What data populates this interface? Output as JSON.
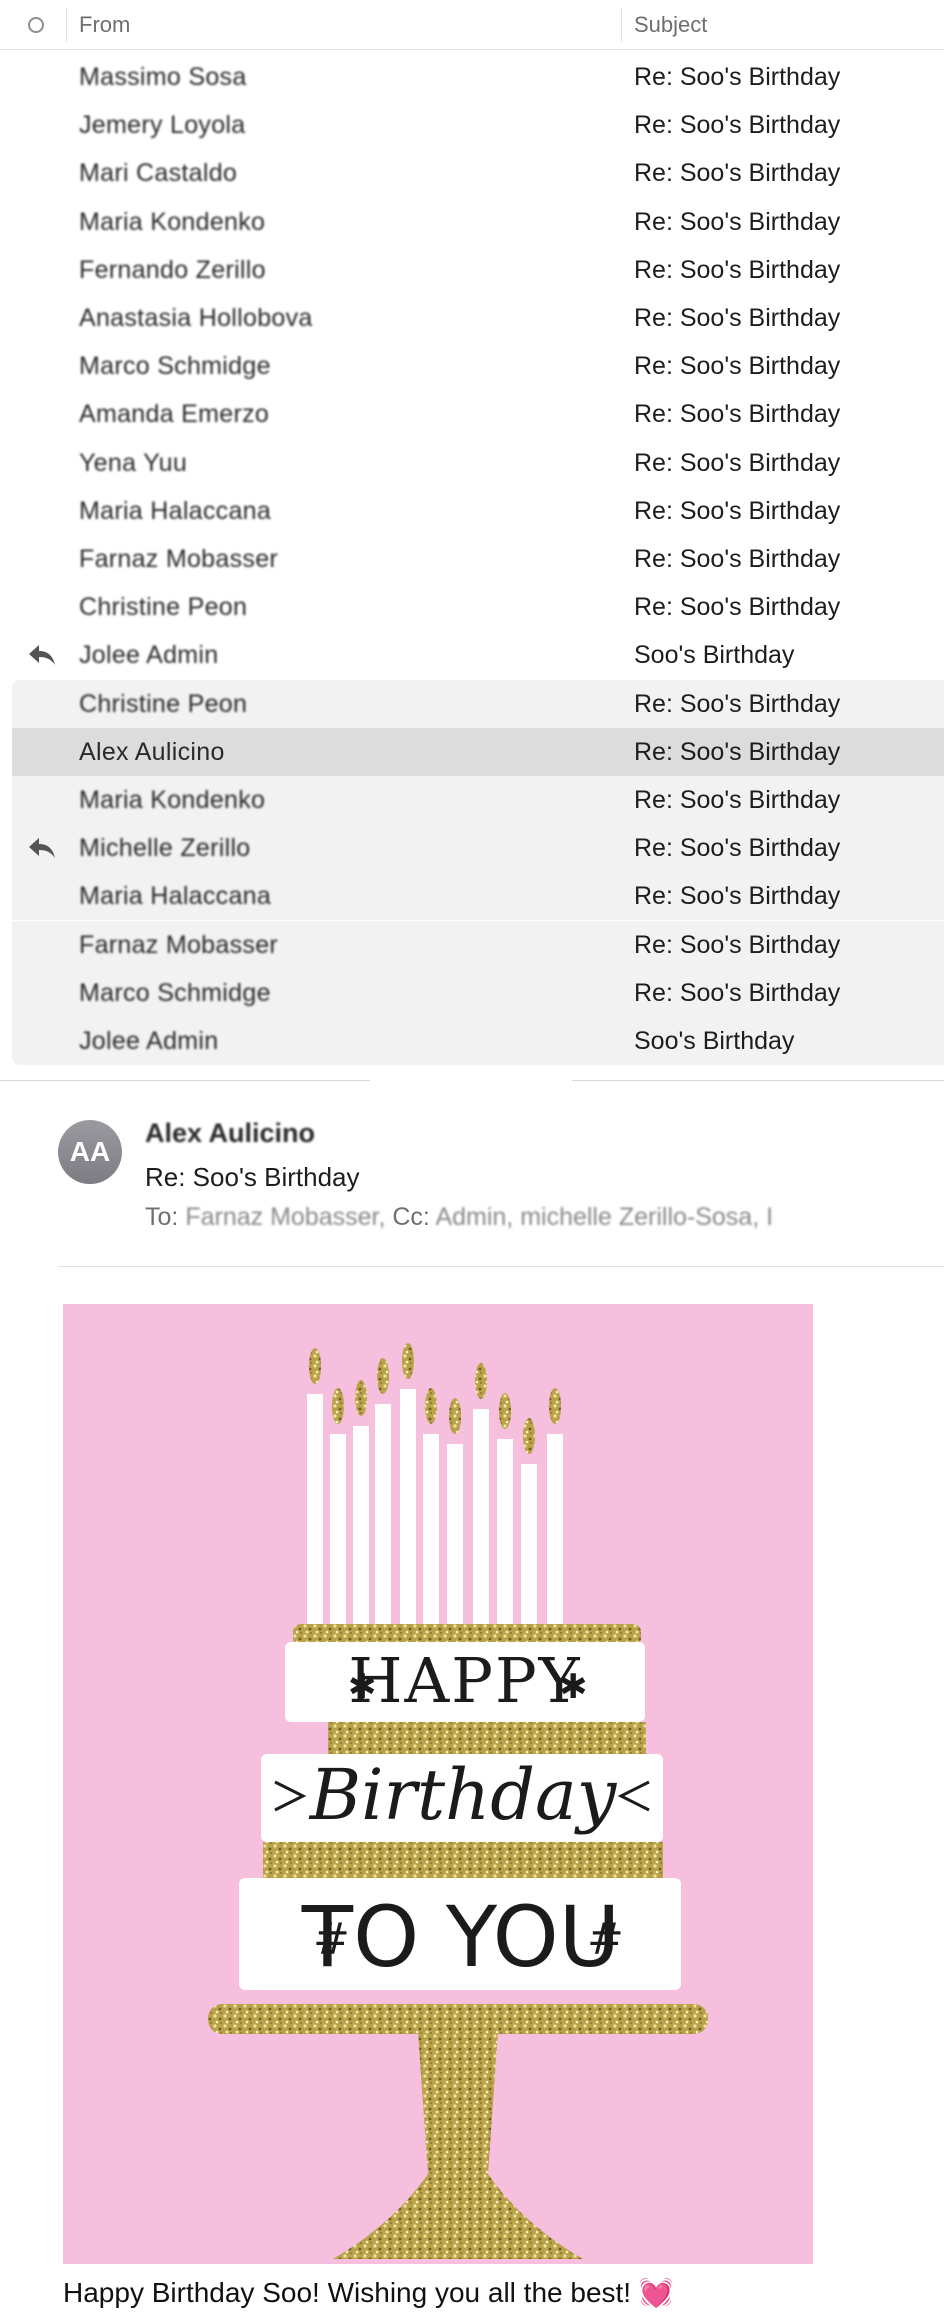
{
  "list": {
    "columns": {
      "from": "From",
      "subject": "Subject"
    },
    "rows": [
      {
        "from": "Massimo Sosa",
        "subject": "Re: Soo's Birthday",
        "replied": false
      },
      {
        "from": "Jemery Loyola",
        "subject": "Re: Soo's Birthday",
        "replied": false
      },
      {
        "from": "Mari Castaldo",
        "subject": "Re: Soo's Birthday",
        "replied": false
      },
      {
        "from": "Maria Kondenko",
        "subject": "Re: Soo's Birthday",
        "replied": false
      },
      {
        "from": "Fernando Zerillo",
        "subject": "Re: Soo's Birthday",
        "replied": false
      },
      {
        "from": "Anastasia Hollobova",
        "subject": "Re: Soo's Birthday",
        "replied": false
      },
      {
        "from": "Marco Schmidge",
        "subject": "Re: Soo's Birthday",
        "replied": false
      },
      {
        "from": "Amanda Emerzo",
        "subject": "Re: Soo's Birthday",
        "replied": false
      },
      {
        "from": "Yena Yuu",
        "subject": "Re: Soo's Birthday",
        "replied": false
      },
      {
        "from": "Maria Halaccana",
        "subject": "Re: Soo's Birthday",
        "replied": false
      },
      {
        "from": "Farnaz Mobasser",
        "subject": "Re: Soo's Birthday",
        "replied": false
      },
      {
        "from": "Christine Peon",
        "subject": "Re: Soo's Birthday",
        "replied": false
      },
      {
        "from": "Jolee Admin",
        "subject": "Soo's Birthday",
        "replied": true
      }
    ],
    "thread_rows": [
      {
        "from": "Christine Peon",
        "subject": "Re: Soo's Birthday",
        "replied": false
      },
      {
        "from": "Alex Aulicino",
        "subject": "Re: Soo's Birthday",
        "replied": false,
        "selected": true
      },
      {
        "from": "Maria Kondenko",
        "subject": "Re: Soo's Birthday",
        "replied": false
      },
      {
        "from": "Michelle Zerillo",
        "subject": "Re: Soo's Birthday",
        "replied": true
      },
      {
        "from": "Maria Halaccana",
        "subject": "Re: Soo's Birthday",
        "replied": false
      },
      {
        "from": "Farnaz Mobasser",
        "subject": "Re: Soo's Birthday",
        "replied": false
      },
      {
        "from": "Marco Schmidge",
        "subject": "Re: Soo's Birthday",
        "replied": false
      },
      {
        "from": "Jolee Admin",
        "subject": "Soo's Birthday",
        "replied": false
      }
    ]
  },
  "message": {
    "avatar_initials": "AA",
    "sender": "Alex Aulicino",
    "subject": "Re: Soo's Birthday",
    "to_label": "To:",
    "to_value": "Farnaz Mobasser,",
    "cc_label": "Cc:",
    "cc_value": "Admin,   michelle Zerillo-Sosa,   I",
    "card": {
      "line1": "HAPPY",
      "line2": "Birthday",
      "line3": "TO YOU"
    },
    "body": "Happy Birthday Soo!  Wishing you all the best!",
    "body_emoji": "💓"
  },
  "colors": {
    "card_pink": "#f6bfdd",
    "glitter_gold": "#c9b45a",
    "selected_row": "#dcdcdc",
    "thread_bg": "#f2f2f2"
  },
  "icons": {
    "status_header": "circle-outline-icon",
    "replied": "reply-arrow-icon"
  }
}
